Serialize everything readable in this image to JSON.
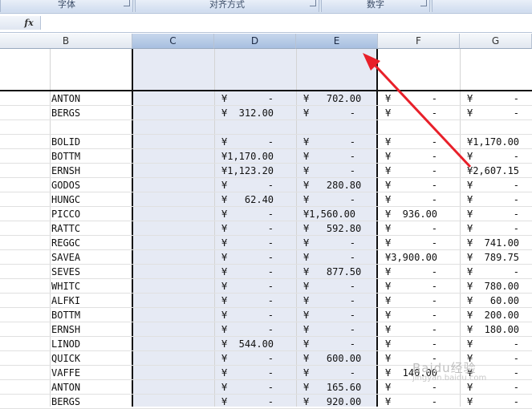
{
  "ribbon": {
    "groups": [
      {
        "label": "字体"
      },
      {
        "label": "对齐方式"
      },
      {
        "label": "数字"
      },
      {
        "label": ""
      }
    ]
  },
  "formula_bar": {
    "fx_label": "fx",
    "value": ""
  },
  "columns": [
    "B",
    "C",
    "D",
    "E",
    "F",
    "G"
  ],
  "selected_columns": [
    "C",
    "D",
    "E"
  ],
  "rows": [
    {
      "b": "ANTON",
      "d": "¥       -",
      "e": "¥   702.00",
      "f": "¥       -",
      "g": "¥       -"
    },
    {
      "b": "BERGS",
      "d": "¥  312.00",
      "e": "¥       -",
      "f": "¥       -",
      "g": "¥       -"
    },
    {
      "b": "",
      "d": "",
      "e": "",
      "f": "",
      "g": ""
    },
    {
      "b": "BOLID",
      "d": "¥       -",
      "e": "¥       -",
      "f": "¥       -",
      "g": "¥1,170.00"
    },
    {
      "b": "BOTTM",
      "d": "¥1,170.00",
      "e": "¥       -",
      "f": "¥       -",
      "g": "¥       -"
    },
    {
      "b": "ERNSH",
      "d": "¥1,123.20",
      "e": "¥       -",
      "f": "¥       -",
      "g": "¥2,607.15"
    },
    {
      "b": "GODOS",
      "d": "¥       -",
      "e": "¥   280.80",
      "f": "¥       -",
      "g": "¥       -"
    },
    {
      "b": "HUNGC",
      "d": "¥   62.40",
      "e": "¥       -",
      "f": "¥       -",
      "g": "¥       -"
    },
    {
      "b": "PICCO",
      "d": "¥       -",
      "e": "¥1,560.00",
      "f": "¥  936.00",
      "g": "¥       -"
    },
    {
      "b": "RATTC",
      "d": "¥       -",
      "e": "¥   592.80",
      "f": "¥       -",
      "g": "¥       -"
    },
    {
      "b": "REGGC",
      "d": "¥       -",
      "e": "¥       -",
      "f": "¥       -",
      "g": "¥  741.00"
    },
    {
      "b": "SAVEA",
      "d": "¥       -",
      "e": "¥       -",
      "f": "¥3,900.00",
      "g": "¥  789.75"
    },
    {
      "b": "SEVES",
      "d": "¥       -",
      "e": "¥   877.50",
      "f": "¥       -",
      "g": "¥       -"
    },
    {
      "b": "WHITC",
      "d": "¥       -",
      "e": "¥       -",
      "f": "¥       -",
      "g": "¥  780.00"
    },
    {
      "b": "ALFKI",
      "d": "¥       -",
      "e": "¥       -",
      "f": "¥       -",
      "g": "¥   60.00"
    },
    {
      "b": "BOTTM",
      "d": "¥       -",
      "e": "¥       -",
      "f": "¥       -",
      "g": "¥  200.00"
    },
    {
      "b": "ERNSH",
      "d": "¥       -",
      "e": "¥       -",
      "f": "¥       -",
      "g": "¥  180.00"
    },
    {
      "b": "LINOD",
      "d": "¥  544.00",
      "e": "¥       -",
      "f": "¥       -",
      "g": "¥       -"
    },
    {
      "b": "QUICK",
      "d": "¥       -",
      "e": "¥   600.00",
      "f": "¥       -",
      "g": "¥       -"
    },
    {
      "b": "VAFFE",
      "d": "¥       -",
      "e": "¥       -",
      "f": "¥  140.00",
      "g": "¥       -"
    },
    {
      "b": "ANTON",
      "d": "¥       -",
      "e": "¥   165.60",
      "f": "¥       -",
      "g": "¥       -"
    },
    {
      "b": "BERGS",
      "d": "¥       -",
      "e": "¥   920.00",
      "f": "¥       -",
      "g": "¥       -"
    }
  ],
  "watermark": {
    "line1": "Baidu经验",
    "line2": "jingyan.baidu.com"
  },
  "colors": {
    "arrow": "#e8202a",
    "selection": "#e6eaf4",
    "header_selected": "#a7bfe0"
  }
}
